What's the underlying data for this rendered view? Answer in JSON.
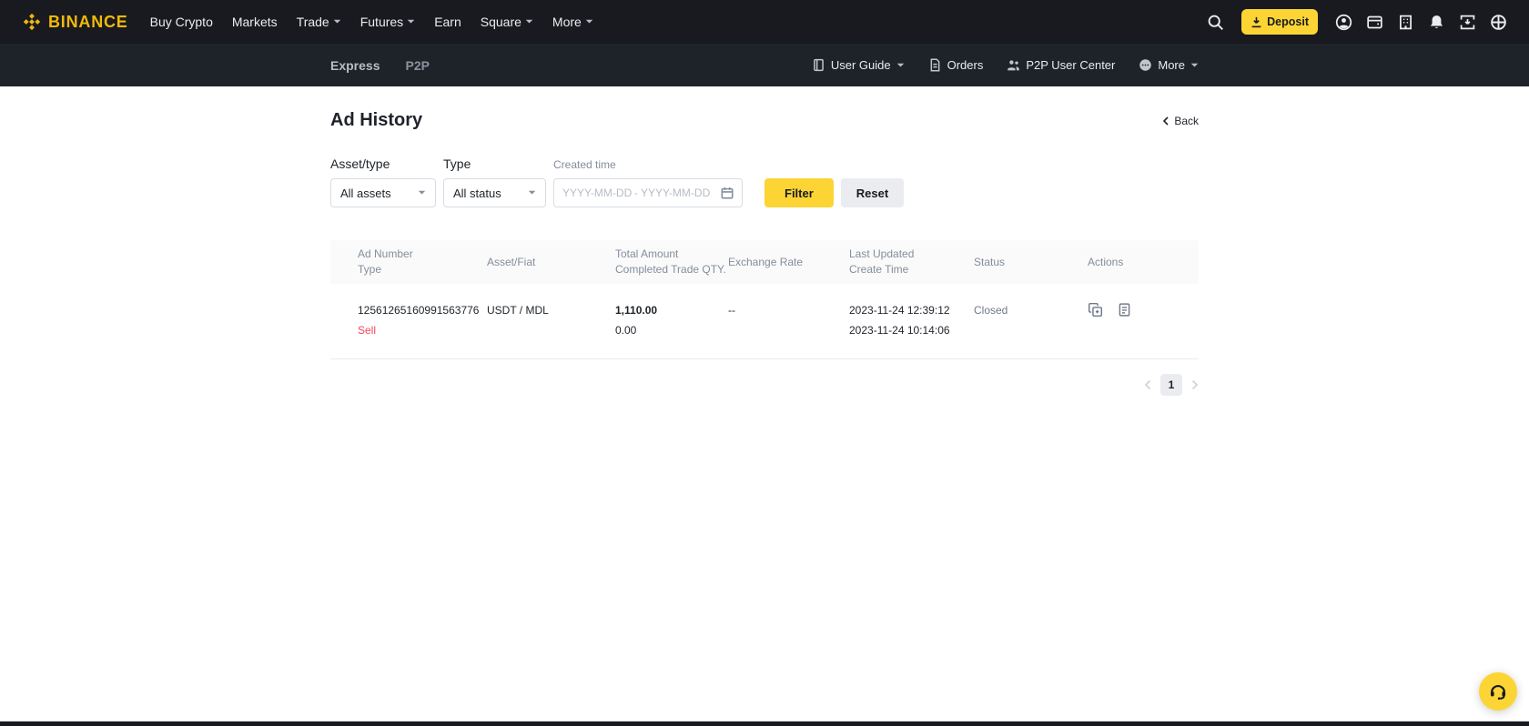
{
  "colors": {
    "brand_yellow": "#F0B90B",
    "accent_yellow": "#FCD535",
    "nav_dark": "#181A20",
    "subnav_dark": "#1E2329",
    "text_dark": "#1E2329",
    "text_gray": "#707A8A",
    "label_gray": "#848E9C",
    "sell_red": "#F6465D",
    "border_gray": "#EAECEF"
  },
  "icons": {
    "binance-logo": "diamond-mark",
    "search-icon": "magnifier",
    "deposit-icon": "download-arrow",
    "profile-icon": "person-circle",
    "wallet-icon": "wallet-card",
    "orders-building-icon": "building-windows",
    "bell-icon": "bell",
    "app-download-icon": "square-down-arrow",
    "globe-icon": "globe",
    "user-guide-icon": "book",
    "orders-file-icon": "document",
    "p2p-user-center-icon": "people",
    "more-circle-icon": "ellipsis-circle",
    "chevron-down-icon": "▾",
    "chevron-left-icon": "‹",
    "calendar-icon": "calendar",
    "copy-ad-icon": "copy-plus",
    "ad-detail-icon": "document-lines",
    "chat-support-icon": "headset"
  },
  "topnav": {
    "brand": "BINANCE",
    "items": [
      {
        "label": "Buy Crypto",
        "caret": false
      },
      {
        "label": "Markets",
        "caret": false
      },
      {
        "label": "Trade",
        "caret": true
      },
      {
        "label": "Futures",
        "caret": true
      },
      {
        "label": "Earn",
        "caret": false
      },
      {
        "label": "Square",
        "caret": true
      },
      {
        "label": "More",
        "caret": true
      }
    ],
    "deposit_label": "Deposit"
  },
  "subnav": {
    "tabs": [
      {
        "label": "Express"
      },
      {
        "label": "P2P"
      }
    ],
    "links": [
      {
        "label": "User Guide",
        "caret": true
      },
      {
        "label": "Orders",
        "caret": false
      },
      {
        "label": "P2P User Center",
        "caret": false
      },
      {
        "label": "More",
        "caret": true
      }
    ]
  },
  "page": {
    "title": "Ad History",
    "back_label": "Back"
  },
  "filters": {
    "asset_label": "Asset/type",
    "asset_value": "All assets",
    "type_label": "Type",
    "type_value": "All status",
    "created_label": "Created time",
    "date_start_placeholder": "YYYY-MM-DD",
    "date_separator": "-",
    "date_end_placeholder": "YYYY-MM-DD",
    "filter_button": "Filter",
    "reset_button": "Reset"
  },
  "table": {
    "headers": [
      {
        "line1": "Ad Number",
        "line2": "Type"
      },
      {
        "line1": "Asset/Fiat",
        "line2": ""
      },
      {
        "line1": "Total Amount",
        "line2": "Completed Trade QTY."
      },
      {
        "line1": "Exchange Rate",
        "line2": ""
      },
      {
        "line1": "Last Updated",
        "line2": "Create Time"
      },
      {
        "line1": "Status",
        "line2": ""
      },
      {
        "line1": "Actions",
        "line2": ""
      }
    ],
    "rows": [
      {
        "ad_number": "12561265160991563776",
        "type": "Sell",
        "asset_fiat": "USDT / MDL",
        "total_amount": "1,110.00",
        "completed_qty": "0.00",
        "exchange_rate": "--",
        "last_updated": "2023-11-24 12:39:12",
        "create_time": "2023-11-24 10:14:06",
        "status": "Closed"
      }
    ]
  },
  "pagination": {
    "current_page": "1"
  }
}
